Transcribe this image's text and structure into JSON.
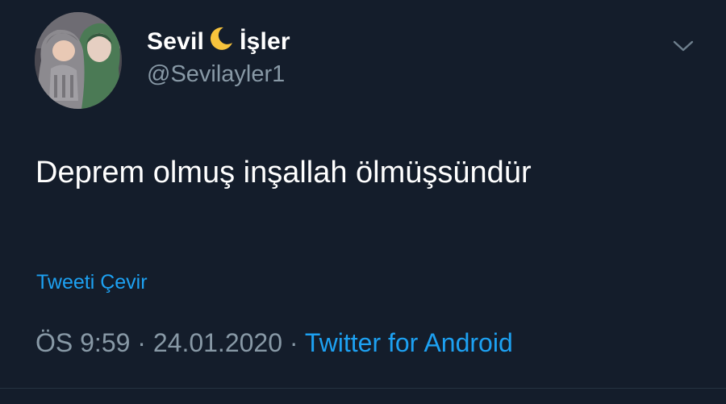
{
  "tweet": {
    "author": {
      "name_first": "Sevil",
      "name_emoji": "crescent-moon-icon",
      "name_last": "İşler",
      "handle": "@Sevilayler1"
    },
    "text": "Deprem olmuş inşallah ölmüşsündür",
    "translate_label": "Tweeti Çevir",
    "time": "ÖS 9:59",
    "separator": "·",
    "date": "24.01.2020",
    "source": "Twitter for Android"
  },
  "colors": {
    "background": "#141d2b",
    "link": "#1da1f2",
    "secondary_text": "#8899a6"
  }
}
